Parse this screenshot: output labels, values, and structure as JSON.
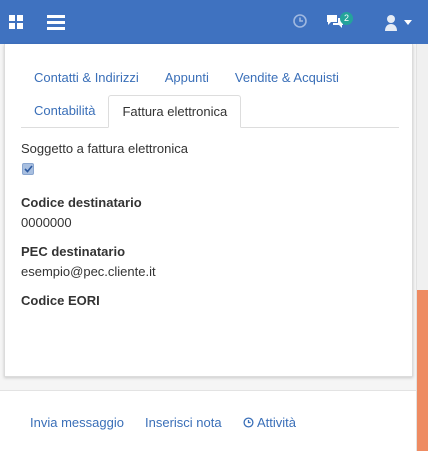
{
  "navbar": {
    "apps_icon": "apps-grid-icon",
    "menu_icon": "hamburger-menu-icon",
    "activity_icon": "clock-icon",
    "messages_icon": "chat-bubbles-icon",
    "messages_badge": "2",
    "user_icon": "user-avatar-icon",
    "color": "#3f72c0"
  },
  "tabs": {
    "row1": [
      "Contatti & Indirizzi",
      "Appunti",
      "Vendite & Acquisti"
    ],
    "row2": [
      "Contabilità",
      "Fattura elettronica"
    ],
    "active": "Fattura elettronica"
  },
  "form": {
    "einvoice_label": "Soggetto a fattura elettronica",
    "einvoice_checked": true,
    "recipient_code_label": "Codice destinatario",
    "recipient_code_value": "0000000",
    "pec_label": "PEC destinatario",
    "pec_value": "esempio@pec.cliente.it",
    "eori_label": "Codice EORI",
    "eori_value": ""
  },
  "actions": {
    "send_message": "Invia messaggio",
    "log_note": "Inserisci nota",
    "activity": "Attività"
  },
  "scrollbar_color": "#ee8b62"
}
